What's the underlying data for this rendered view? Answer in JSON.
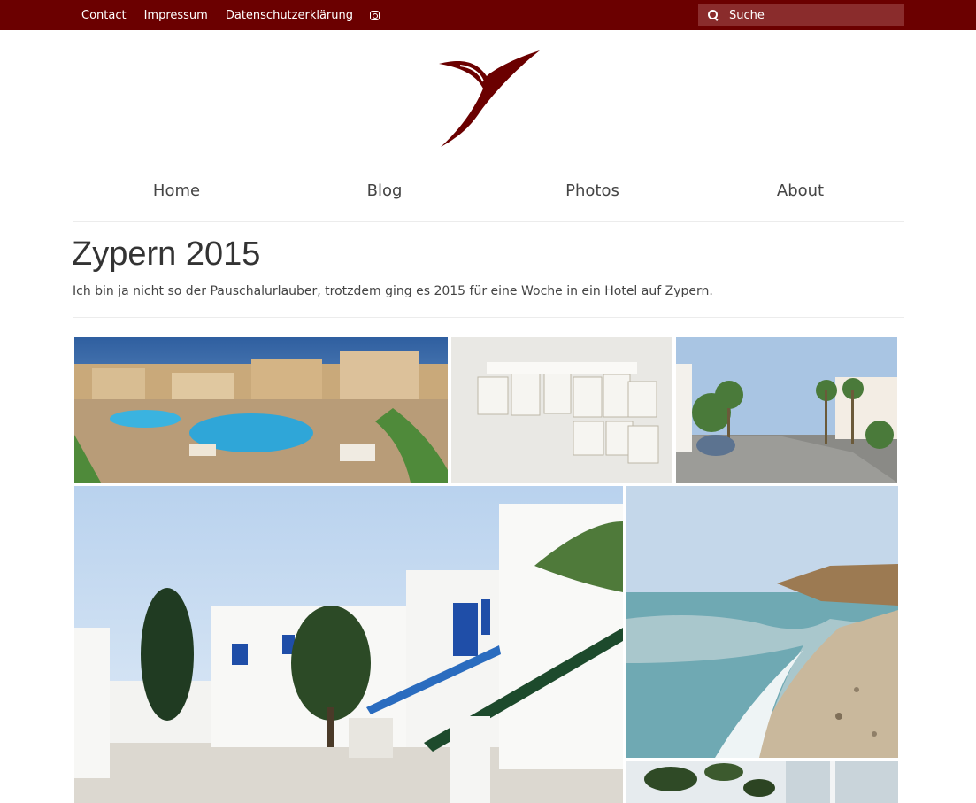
{
  "topbar": {
    "links": [
      "Contact",
      "Impressum",
      "Datenschutzerklärung"
    ],
    "instagram_icon": "instagram-icon",
    "search_placeholder": "Suche",
    "background": "#6b0000"
  },
  "logo": {
    "icon": "stylized-seven-logo",
    "color": "#6b0000"
  },
  "nav": {
    "items": [
      "Home",
      "Blog",
      "Photos",
      "About"
    ]
  },
  "page": {
    "title": "Zypern 2015",
    "description": "Ich bin ja nicht so der Pauschalurlauber, trotzdem ging es 2015 für eine Woche in ein Hotel auf Zypern."
  },
  "gallery": {
    "photos": [
      "resort-pool-panorama",
      "white-mailboxes-on-wall",
      "street-with-palms-and-beetle",
      "white-houses-with-stairs",
      "beach-with-waves",
      "plant-in-front-of-window"
    ]
  }
}
